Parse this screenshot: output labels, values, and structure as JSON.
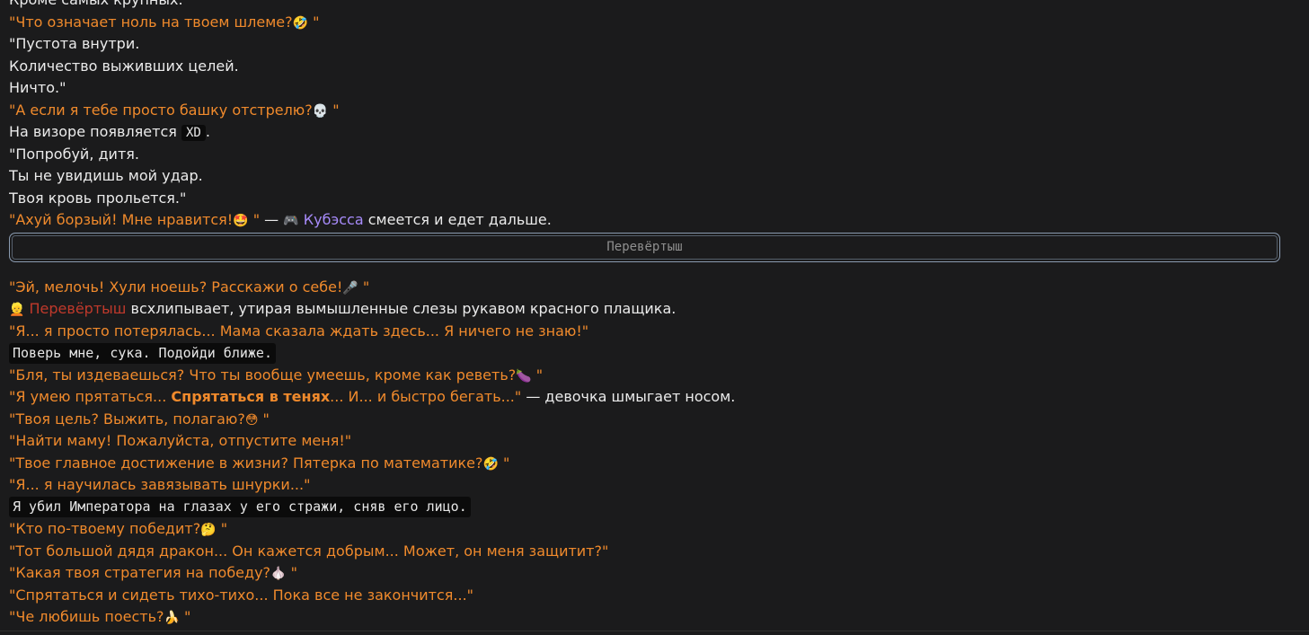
{
  "lines_top": [
    {
      "text": "Кроме самых крупных."
    },
    {
      "text": "\"Что означает ноль на твоем шлеме?",
      "emoji": "🤣",
      "tail": " \""
    },
    {
      "text": "\"Пустота внутри."
    },
    {
      "text": "Количество выживших целей."
    },
    {
      "text": "Ничто.\""
    },
    {
      "text": "\"А если я тебе просто башку отстрелю?",
      "emoji": "💀",
      "tail": " \""
    },
    {
      "pre": "На визоре появляется ",
      "code": "XD",
      "post": "."
    },
    {
      "text": "\"Попробуй, дитя."
    },
    {
      "text": "Ты не увидишь мой удар."
    },
    {
      "text": "Твоя кровь прольется.\""
    },
    {
      "quote": "\"Ахуй борзый! Мне нравится!",
      "emoji": "🤩",
      "quote_end": " \"",
      "dash": " — ",
      "name_icon": "🎮",
      "name": " Кубэсса",
      "rest": " смеется и едет дальше."
    }
  ],
  "section_button": {
    "label": "Перевёртыш"
  },
  "lines_bottom": [
    {
      "text": "\"Эй, мелочь! Хули ноешь? Расскажи о себе!",
      "emoji": "🎤",
      "tail": " \""
    },
    {
      "icon": "👱",
      "name": " Перевёртыш",
      "rest": " всхлипывает, утирая вымышленные слезы рукавом красного плащика."
    },
    {
      "text": "\"Я... я просто потерялась... Мама сказала ждать здесь... Я ничего не знаю!\""
    },
    {
      "code_block": "Поверь мне, сука. Подойди ближе."
    },
    {
      "text": "\"Бля, ты издеваешься? Что ты вообще умеешь, кроме как реветь?",
      "emoji": "🍆",
      "tail": " \""
    },
    {
      "q1": "\"Я умею прятаться... ",
      "q_bold": "Спрятаться в тенях",
      "q2": "... И... и быстро бегать...\"",
      "rest": " — девочка шмыгает носом."
    },
    {
      "text": "\"Твоя цель? Выжить, полагаю?",
      "emoji": "😳",
      "tail": " \""
    },
    {
      "text": "\"Найти маму! Пожалуйста, отпустите меня!\""
    },
    {
      "text": "\"Твое главное достижение в жизни? Пятерка по математике?",
      "emoji": "🤣",
      "tail": " \""
    },
    {
      "text": "\"Я... я научилась завязывать шнурки...\""
    },
    {
      "code_block": "Я убил Императора на глазах у его стражи, сняв его лицо."
    },
    {
      "text": "\"Кто по-твоему победит?",
      "emoji": "🤔",
      "tail": " \""
    },
    {
      "text": "\"Тот большой дядя дракон... Он кажется добрым... Может, он меня защитит?\""
    },
    {
      "text": "\"Какая твоя стратегия на победу?",
      "emoji": "🧄",
      "tail": " \""
    },
    {
      "text": "\"Спрятаться и сидеть тихо-тихо... Пока все не закончится...\""
    },
    {
      "text": "\"Че любишь поесть?",
      "emoji": "🍌",
      "tail": " \""
    }
  ]
}
